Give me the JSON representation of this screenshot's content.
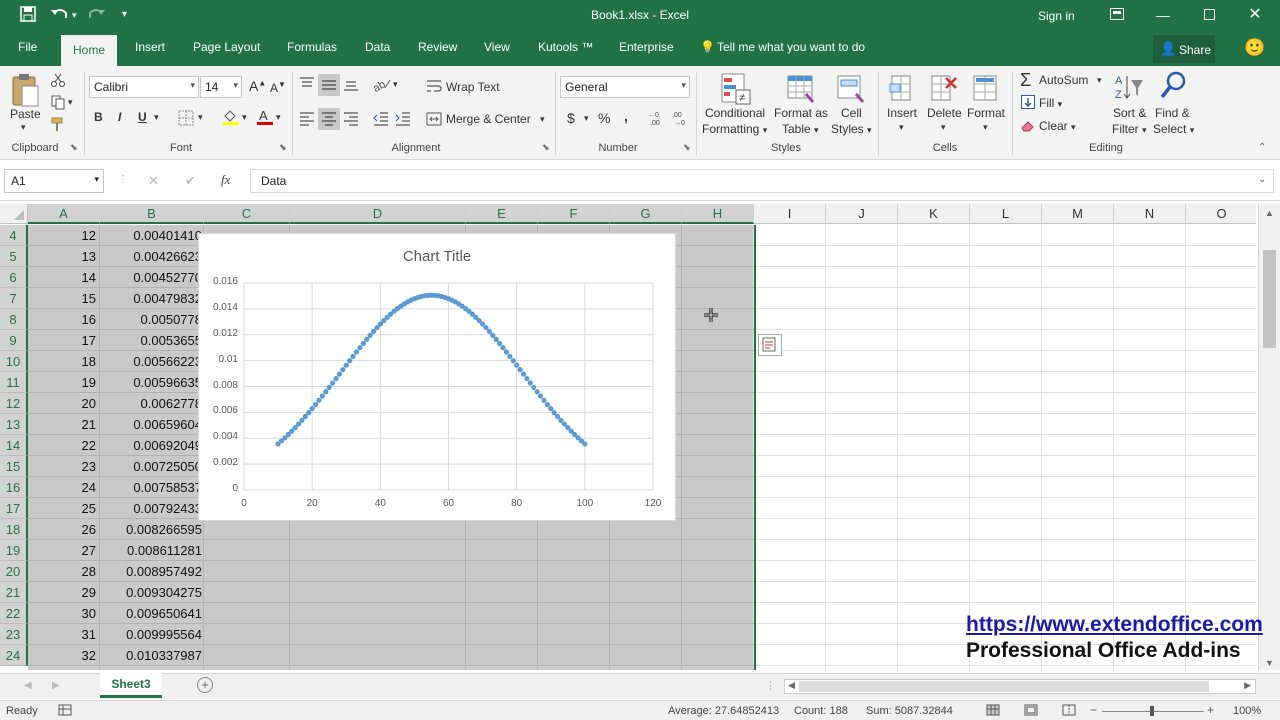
{
  "window": {
    "title": "Book1.xlsx  -  Excel",
    "sign_in": "Sign in"
  },
  "menu": {
    "tabs": [
      "File",
      "Home",
      "Insert",
      "Page Layout",
      "Formulas",
      "Data",
      "Review",
      "View",
      "Kutools ™",
      "Enterprise"
    ],
    "active": "Home",
    "tell_me": "Tell me what you want to do",
    "share": "Share"
  },
  "ribbon": {
    "clipboard": {
      "label": "Clipboard",
      "paste": "Paste"
    },
    "font": {
      "label": "Font",
      "name": "Calibri",
      "size": "14",
      "bold": "B",
      "italic": "I",
      "underline": "U"
    },
    "alignment": {
      "label": "Alignment",
      "wrap_text": "Wrap Text",
      "merge_center": "Merge & Center"
    },
    "number": {
      "label": "Number",
      "format": "General",
      "currency": "$",
      "percent": "%",
      "comma": ","
    },
    "styles": {
      "label": "Styles",
      "conditional": [
        "Conditional",
        "Formatting"
      ],
      "format_table": [
        "Format as",
        "Table"
      ],
      "cell_styles": [
        "Cell",
        "Styles"
      ]
    },
    "cells": {
      "label": "Cells",
      "insert": "Insert",
      "delete": "Delete",
      "format": "Format"
    },
    "editing": {
      "label": "Editing",
      "autosum": "AutoSum",
      "fill": "Fill",
      "clear": "Clear",
      "sort_filter": [
        "Sort &",
        "Filter"
      ],
      "find_select": [
        "Find &",
        "Select"
      ]
    }
  },
  "formula_bar": {
    "name_box": "A1",
    "cancel": "✕",
    "enter": "✔",
    "fx": "fx",
    "value": "Data"
  },
  "columns": [
    "A",
    "B",
    "C",
    "D",
    "E",
    "F",
    "G",
    "H",
    "I",
    "J",
    "K",
    "L",
    "M",
    "N",
    "O"
  ],
  "rows": [
    {
      "n": "4",
      "a": "12",
      "b": "0.00401410"
    },
    {
      "n": "5",
      "a": "13",
      "b": "0.00426623"
    },
    {
      "n": "6",
      "a": "14",
      "b": "0.00452770"
    },
    {
      "n": "7",
      "a": "15",
      "b": "0.00479832"
    },
    {
      "n": "8",
      "a": "16",
      "b": "0.0050778"
    },
    {
      "n": "9",
      "a": "17",
      "b": "0.0053655"
    },
    {
      "n": "10",
      "a": "18",
      "b": "0.00566223"
    },
    {
      "n": "11",
      "a": "19",
      "b": "0.00596635"
    },
    {
      "n": "12",
      "a": "20",
      "b": "0.0062778"
    },
    {
      "n": "13",
      "a": "21",
      "b": "0.00659604"
    },
    {
      "n": "14",
      "a": "22",
      "b": "0.00692049"
    },
    {
      "n": "15",
      "a": "23",
      "b": "0.00725050"
    },
    {
      "n": "16",
      "a": "24",
      "b": "0.00758537"
    },
    {
      "n": "17",
      "a": "25",
      "b": "0.00792433"
    },
    {
      "n": "18",
      "a": "26",
      "b": "0.008266595"
    },
    {
      "n": "19",
      "a": "27",
      "b": "0.008611281"
    },
    {
      "n": "20",
      "a": "28",
      "b": "0.008957492"
    },
    {
      "n": "21",
      "a": "29",
      "b": "0.009304275"
    },
    {
      "n": "22",
      "a": "30",
      "b": "0.009650641"
    },
    {
      "n": "23",
      "a": "31",
      "b": "0.009995564"
    },
    {
      "n": "24",
      "a": "32",
      "b": "0.010337987"
    }
  ],
  "chart_data": {
    "type": "scatter",
    "title": "Chart Title",
    "xlim": [
      0,
      120
    ],
    "ylim": [
      0,
      0.016
    ],
    "xticks": [
      "0",
      "20",
      "40",
      "60",
      "80",
      "100",
      "120"
    ],
    "yticks": [
      "0",
      "0.002",
      "0.004",
      "0.006",
      "0.008",
      "0.01",
      "0.012",
      "0.014",
      "0.016"
    ],
    "grid": true,
    "series": [
      {
        "mean": 55,
        "sd": 26.5,
        "x_start": 10,
        "x_end": 100,
        "step": 1
      }
    ],
    "color": "#5b9bd5"
  },
  "sheets": {
    "active": "Sheet3"
  },
  "status": {
    "ready": "Ready",
    "average": "Average: 27.64852413",
    "count": "Count: 188",
    "sum": "Sum: 5087.32844",
    "zoom": "100%"
  },
  "watermark": {
    "url": "https://www.extendoffice.com",
    "tagline": "Professional Office Add-ins"
  }
}
